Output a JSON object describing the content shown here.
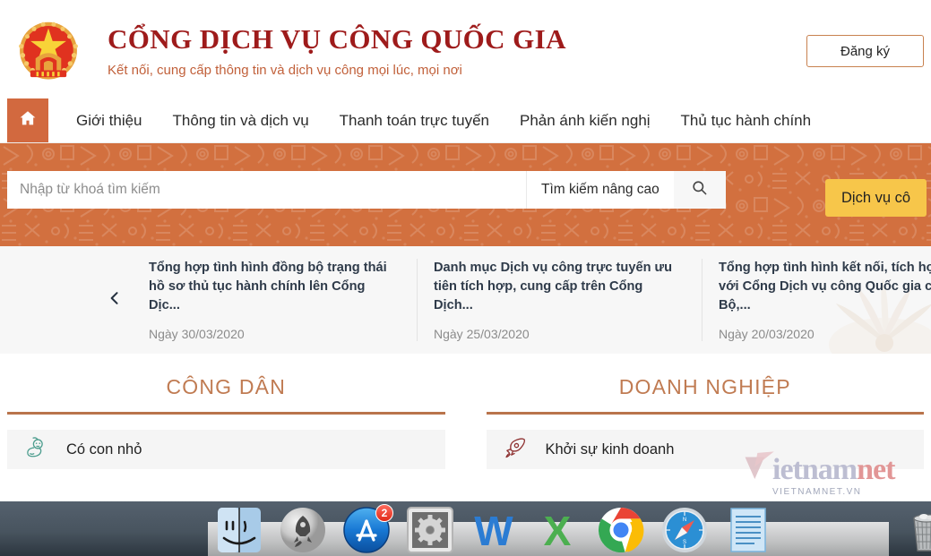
{
  "header": {
    "emblem_icon": "vietnam-national-emblem",
    "title": "CỔNG DỊCH VỤ CÔNG QUỐC GIA",
    "subtitle": "Kết nối, cung cấp thông tin và dịch vụ công mọi lúc, mọi nơi",
    "register_label": "Đăng ký",
    "brand_color": "#9e1b1b",
    "accent_color": "#d2703f"
  },
  "nav": {
    "home_icon": "home-icon",
    "items": [
      {
        "label": "Giới thiệu"
      },
      {
        "label": "Thông tin và dịch vụ"
      },
      {
        "label": "Thanh toán trực tuyến"
      },
      {
        "label": "Phản ánh kiến nghị"
      },
      {
        "label": "Thủ tục hành chính"
      }
    ]
  },
  "search": {
    "placeholder": "Nhập từ khoá tìm kiếm",
    "value": "",
    "advanced_label": "Tìm kiếm nâng cao",
    "search_icon": "search-icon",
    "cta_label": "Dịch vụ cô",
    "cta_color": "#f7c64a"
  },
  "news": {
    "prev_icon": "chevron-left-icon",
    "date_prefix": "Ngày",
    "items": [
      {
        "title": "Tổng hợp tình hình đồng bộ trạng thái hồ sơ thủ tục hành chính lên Cổng Dịc...",
        "date": "Ngày 30/03/2020"
      },
      {
        "title": "Danh mục Dịch vụ công trực tuyến ưu tiên tích hợp, cung cấp trên Cổng Dịch...",
        "date": "Ngày 25/03/2020"
      },
      {
        "title": "Tổng hợp tình hình kết nối, tích hợp với Cổng Dịch vụ công Quốc gia của Bộ,...",
        "date": "Ngày 20/03/2020"
      }
    ]
  },
  "services": {
    "citizen": {
      "heading": "CÔNG DÂN",
      "items": [
        {
          "label": "Có con nhỏ",
          "icon": "baby-icon",
          "icon_color": "#4e9e8f"
        }
      ]
    },
    "business": {
      "heading": "DOANH NGHIỆP",
      "items": [
        {
          "label": "Khởi sự kinh doanh",
          "icon": "rocket-icon",
          "icon_color": "#8e3030"
        }
      ]
    }
  },
  "watermark": {
    "part1": "ietnam",
    "part2": "net",
    "sub": "VIETNAMNET.VN"
  },
  "dock": {
    "items": [
      {
        "name": "finder",
        "label": "Finder",
        "badge": ""
      },
      {
        "name": "launchpad",
        "label": "Launchpad",
        "badge": ""
      },
      {
        "name": "app-store",
        "label": "App Store",
        "badge": "2"
      },
      {
        "name": "system-preferences",
        "label": "System Preferences",
        "badge": ""
      },
      {
        "name": "microsoft-word",
        "label": "Microsoft Word",
        "badge": ""
      },
      {
        "name": "microsoft-excel",
        "label": "Microsoft Excel",
        "badge": ""
      },
      {
        "name": "google-chrome",
        "label": "Google Chrome",
        "badge": ""
      },
      {
        "name": "safari",
        "label": "Safari",
        "badge": ""
      },
      {
        "name": "textedit",
        "label": "TextEdit",
        "badge": ""
      },
      {
        "name": "trash",
        "label": "Trash",
        "badge": ""
      }
    ]
  }
}
